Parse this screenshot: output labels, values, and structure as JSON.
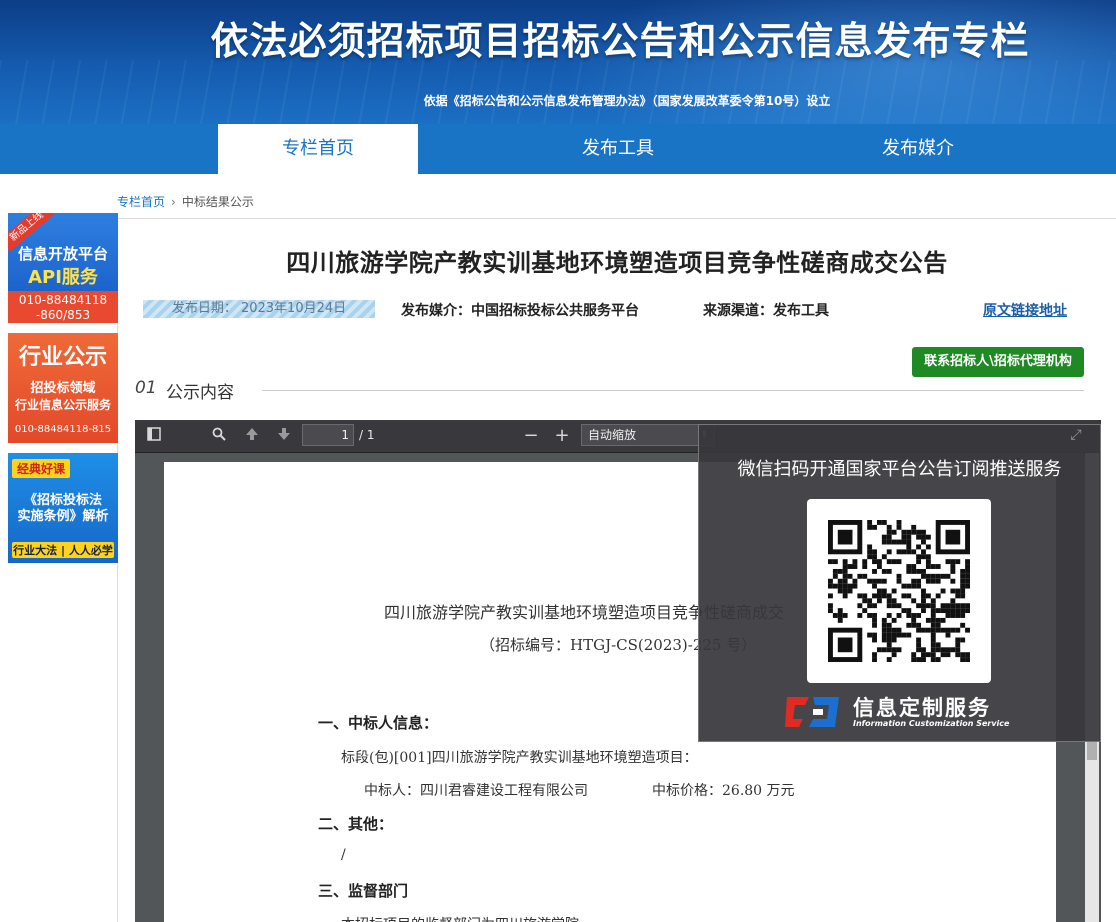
{
  "banner": {
    "title": "依法必须招标项目招标公告和公示信息发布专栏",
    "subtitle": "依据《招标公告和公示信息发布管理办法》（国家发展改革委令第10号）设立"
  },
  "nav": {
    "items": [
      {
        "label": "专栏首页",
        "active": true
      },
      {
        "label": "发布工具",
        "active": false
      },
      {
        "label": "发布媒介",
        "active": false
      }
    ]
  },
  "breadcrumb": {
    "home": "专栏首页",
    "separator": "›",
    "current": "中标结果公示"
  },
  "ads": [
    {
      "corner": "新品上线",
      "line1": "信息开放平台",
      "line2": "API服务",
      "phone1": "010-88484118",
      "phone2": "-860/853"
    },
    {
      "line1": "行业公示",
      "line2": "招投标领域",
      "line3": "行业信息公示服务",
      "phone": "010-88484118-815"
    },
    {
      "tag": "经典好课",
      "line1": "《招标投标法",
      "line1b": "实施条例》解析",
      "line2": "行业大法 | 人人必学"
    }
  ],
  "article": {
    "title": "四川旅游学院产教实训基地环境塑造项目竞争性磋商成交公告",
    "date": "发布日期：  2023年10月24日",
    "media": "发布媒介：中国招标投标公共服务平台",
    "source": "来源渠道：发布工具",
    "original_link": "原文链接地址",
    "contact_button": "联系招标人\\招标代理机构",
    "section_num": "01",
    "section_label": "公示内容"
  },
  "viewer": {
    "page_current": "1",
    "page_total": "/ 1",
    "zoom": "自动缩放",
    "icons": [
      "sidebar-toggle-icon",
      "search-icon",
      "page-up-icon",
      "page-down-icon",
      "zoom-out-icon",
      "zoom-in-icon",
      "fullscreen-icon"
    ]
  },
  "pdf": {
    "title": "四川旅游学院产教实训基地环境塑造项目竞争性磋商成交",
    "code": "（招标编号：HTGJ-CS(2023)-225 号）",
    "h1": "一、中标人信息：",
    "lot": "标段(包)[001]四川旅游学院产教实训基地环境塑造项目：",
    "winner": "中标人：四川君睿建设工程有限公司",
    "price": "中标价格：26.80 万元",
    "h2": "二、其他：",
    "slash": "/",
    "h3": "三、监督部门",
    "last": "本招标项目的监督部门为四川旅游学院"
  },
  "overlay": {
    "title": "微信扫码开通国家平台公告订阅推送服务",
    "logo_text": "信息定制服务",
    "logo_sub": "Information Customization Service"
  },
  "colors": {
    "brand_blue": "#1a74c6",
    "contact_green": "#1f8a24",
    "link_blue": "#1a5fa8"
  }
}
